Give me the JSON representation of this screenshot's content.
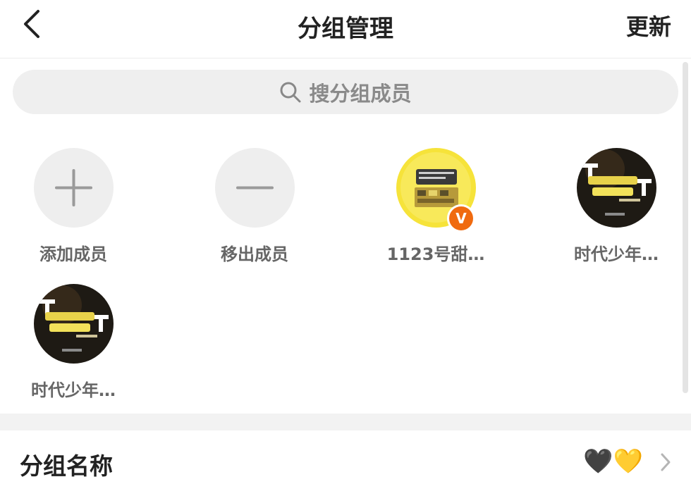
{
  "header": {
    "title": "分组管理",
    "action": "更新",
    "back_icon": "back-arrow-icon"
  },
  "search": {
    "placeholder": "搜分组成员",
    "icon": "search-icon"
  },
  "members": [
    {
      "label": "添加成员",
      "icon": "plus-icon"
    },
    {
      "label": "移出成员",
      "icon": "minus-icon"
    },
    {
      "label": "1123号甜…",
      "verified": true,
      "badge_text": "V"
    },
    {
      "label": "时代少年…"
    },
    {
      "label": "时代少年…"
    }
  ],
  "group": {
    "name_label": "分组名称",
    "name_value": "🖤💛"
  },
  "colors": {
    "badge": "#f06a0f",
    "accent_yellow": "#f6dc2c"
  }
}
